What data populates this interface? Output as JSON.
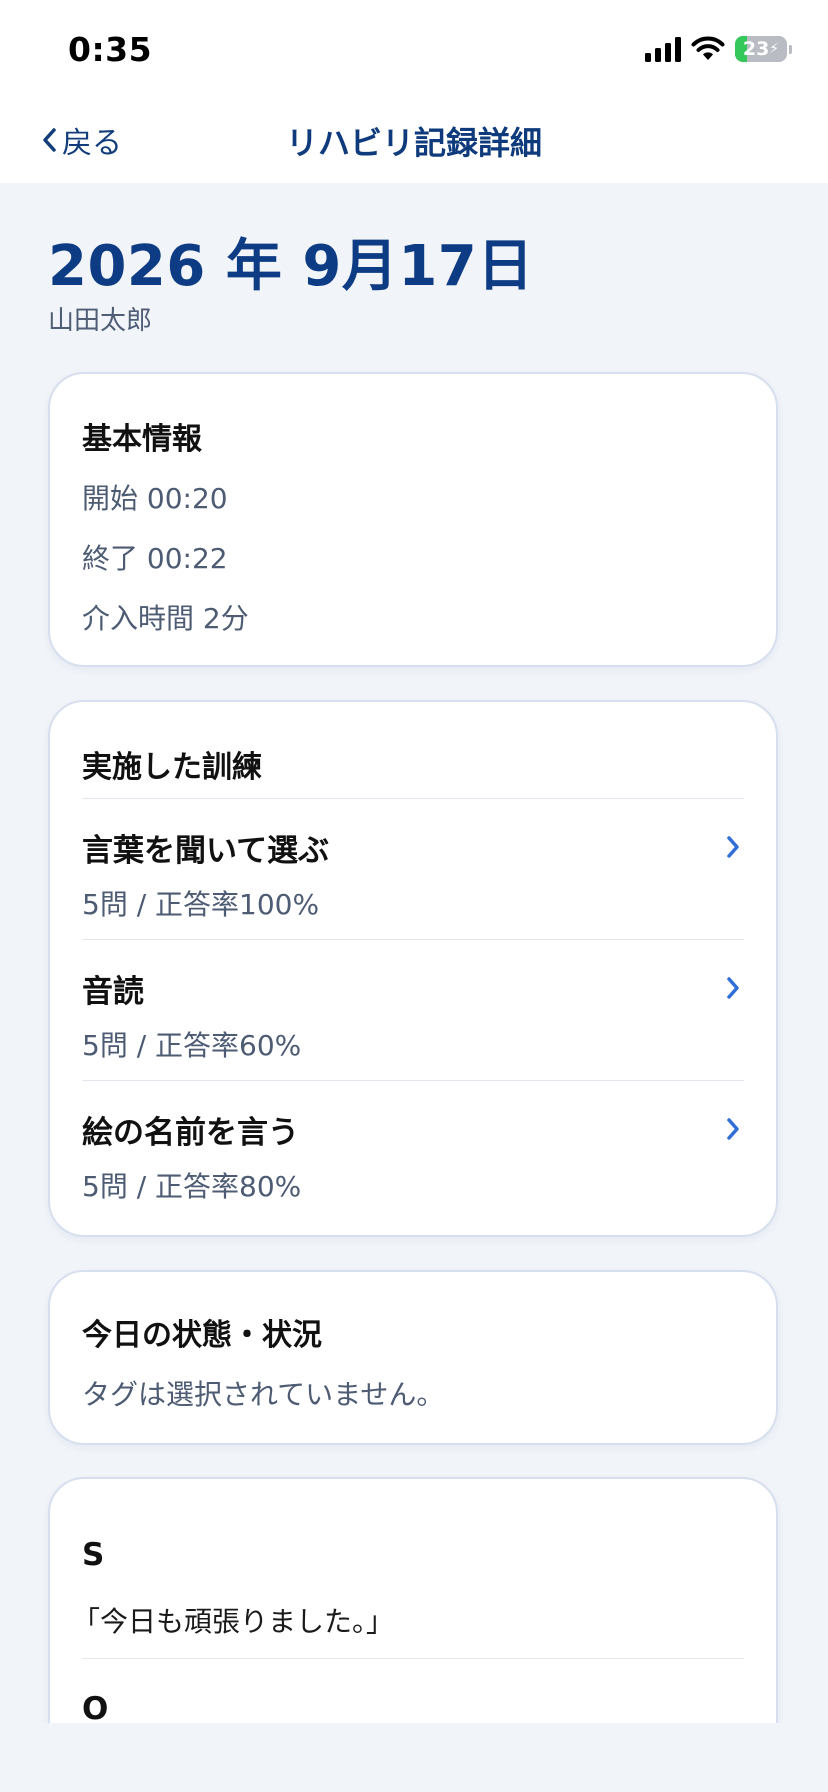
{
  "status_bar": {
    "time": "0:35",
    "battery_level": "23",
    "battery_fraction": 0.23
  },
  "nav": {
    "back_label": "戻る",
    "title": "リハビリ記録詳細"
  },
  "record": {
    "date": "2026 年 9月17日",
    "patient": "山田太郎"
  },
  "basic_info": {
    "title": "基本情報",
    "start": "開始 00:20",
    "end": "終了 00:22",
    "duration": "介入時間 2分"
  },
  "training": {
    "title": "実施した訓練",
    "items": [
      {
        "name": "言葉を聞いて選ぶ",
        "stat": "5問 / 正答率100%"
      },
      {
        "name": "音読",
        "stat": "5問 / 正答率60%"
      },
      {
        "name": "絵の名前を言う",
        "stat": "5問 / 正答率80%"
      }
    ]
  },
  "condition": {
    "title": "今日の状態・状況",
    "tags_empty": "タグは選択されていません。"
  },
  "soap": {
    "s_label": "S",
    "s_text": "「今日も頑張りました。」",
    "o_label": "O"
  },
  "colors": {
    "brand": "#0e3c84",
    "accent": "#2f6fd6",
    "battery_green": "#34c759"
  },
  "icons": {
    "back": "chevron-left-icon",
    "item_arrow": "chevron-right-icon",
    "signal": "cellular-signal-icon",
    "wifi": "wifi-icon",
    "battery": "battery-icon"
  }
}
